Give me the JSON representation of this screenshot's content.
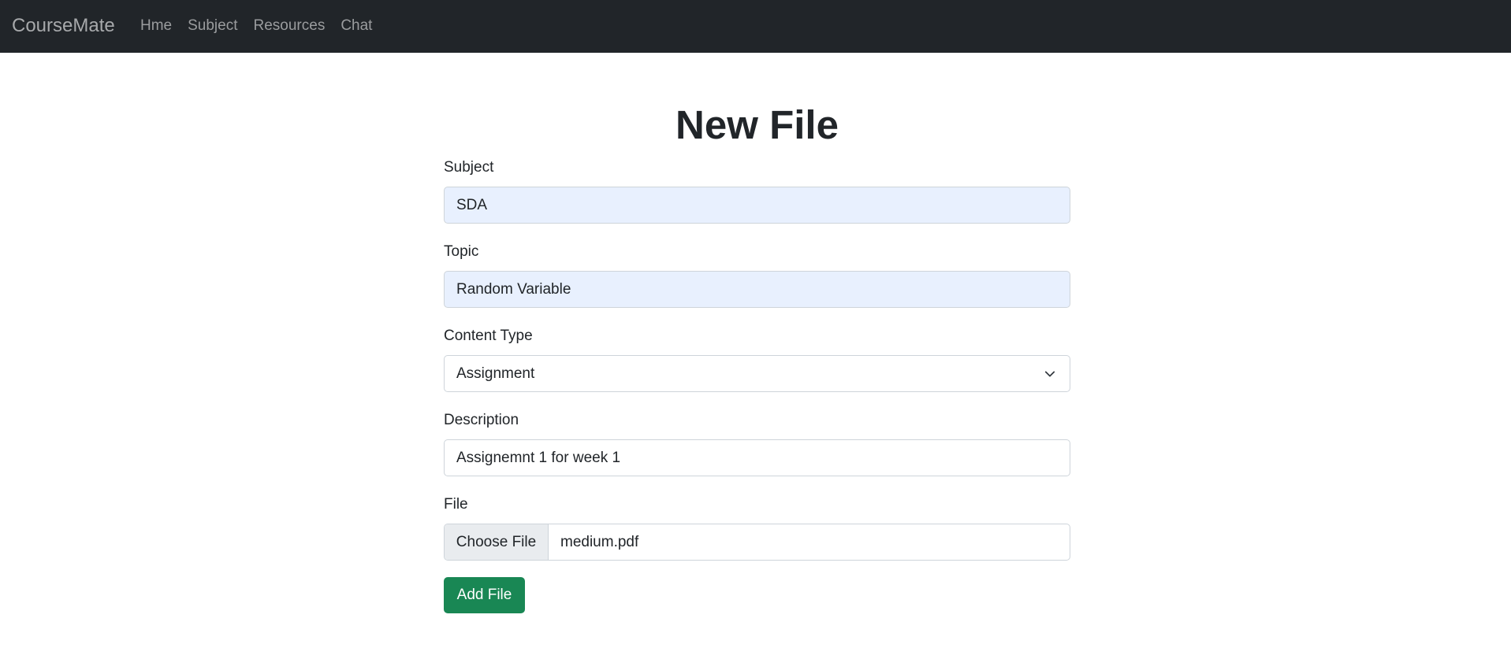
{
  "navbar": {
    "brand": "CourseMate",
    "links": [
      "Hme",
      "Subject",
      "Resources",
      "Chat"
    ]
  },
  "page": {
    "title": "New File"
  },
  "form": {
    "subject": {
      "label": "Subject",
      "value": "SDA"
    },
    "topic": {
      "label": "Topic",
      "value": "Random Variable"
    },
    "content_type": {
      "label": "Content Type",
      "value": "Assignment"
    },
    "description": {
      "label": "Description",
      "value": "Assignemnt 1 for week 1"
    },
    "file": {
      "label": "File",
      "button": "Choose File",
      "filename": "medium.pdf"
    },
    "submit_label": "Add File"
  },
  "colors": {
    "navbar_bg": "#212529",
    "autofill_bg": "#e8f0fe",
    "success": "#198754"
  }
}
